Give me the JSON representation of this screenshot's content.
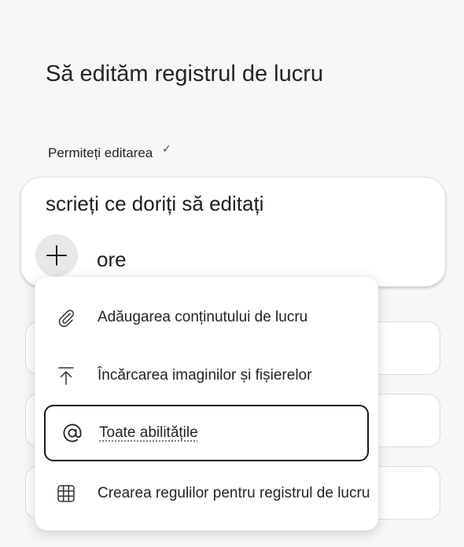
{
  "header": {
    "title": "Să edităm registrul de lucru"
  },
  "permission": {
    "label": "Permiteți editarea",
    "check": "✓"
  },
  "composer": {
    "prompt_text": "scrieți ce doriți să editați",
    "more_label": "ore"
  },
  "menu": {
    "items": [
      {
        "label": "Adăugarea conținutului de lucru",
        "icon": "paperclip-icon"
      },
      {
        "label": "Încărcarea imaginilor și fișierelor",
        "icon": "upload-icon"
      },
      {
        "label": "Toate abilitățile",
        "icon": "at-sign-icon"
      },
      {
        "label": "Crearea regulilor pentru registrul de lucru",
        "icon": "table-grid-icon"
      }
    ]
  }
}
